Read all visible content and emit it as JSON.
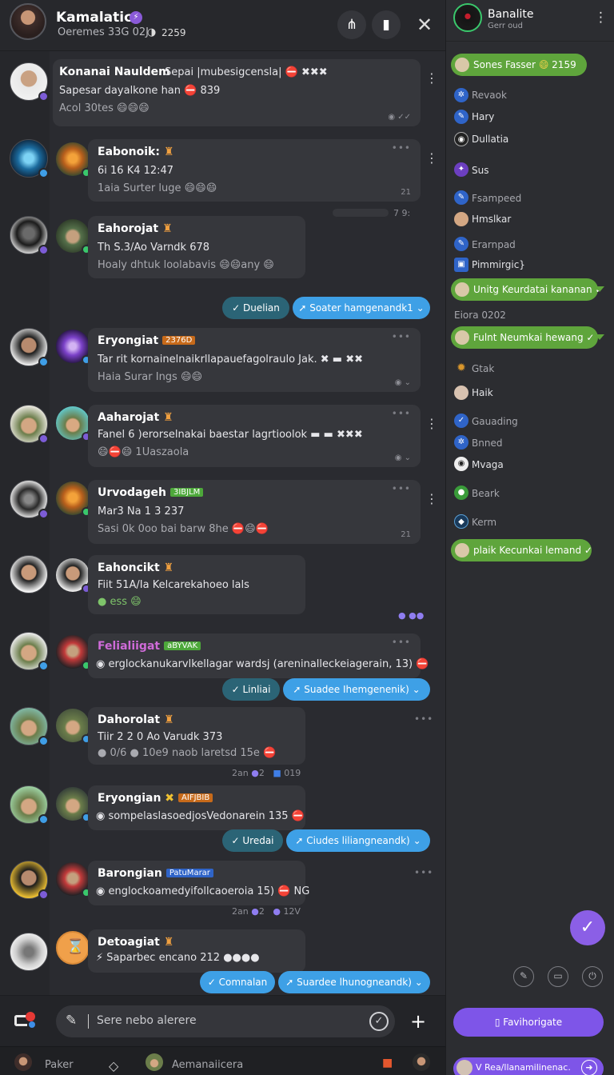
{
  "header": {
    "title": "Kamalatica",
    "subtitle": "Oeremes 33G 02J",
    "time": "2259",
    "badge": "⚡"
  },
  "messages": [
    {
      "name": "Konanai Nauldem",
      "tag": "",
      "lines": [
        "Sepai |mubesigcensla| ⛔ ✖✖✖",
        "Sapesar dayalkone han ⛔ 839",
        "Acol 30tes 😄😄😄"
      ],
      "time": ""
    },
    {
      "name": "Eabonoik:",
      "tag": "",
      "lines": [
        "6i 16 K4 12:47",
        "1aia Surter luge 😄😄😄"
      ],
      "time": "21"
    },
    {
      "name": "Eahorojat",
      "tag": "",
      "lines": [
        "Th S.3/Ao Varndk 678",
        "Hoaly dhtuk loolabavis 😄😄any 😄"
      ],
      "time": ""
    },
    {
      "name": "Eryongiat",
      "tag": "2376D",
      "lines": [
        "Tar rit kornainelnaikrllapauefagolraulo Jak. ✖ ▬ ✖✖",
        "Haia Surar Ings 😄😄"
      ],
      "time": ""
    },
    {
      "name": "Aaharojat",
      "tag": "",
      "lines": [
        "Fanel 6 )erorselnakai baestar lagrtioolok ▬ ▬ ✖✖✖",
        "😄⛔😄 1Uaszaola"
      ],
      "time": ""
    },
    {
      "name": "Urvodageh",
      "tag": "3IBJLM",
      "lines": [
        "Mar3 Na 1 3 237",
        "Sasi 0k 0oo bai barw 8he ⛔😄⛔"
      ],
      "time": "21"
    },
    {
      "name": "Eahoncikt",
      "tag": "",
      "lines": [
        "Fiit 51A/Ia Kelcarekahoeo lals",
        "● ess 😄"
      ],
      "time": ""
    },
    {
      "name": "Felialiigat",
      "tag": "aBYVAK",
      "lines": [
        "◉ erglockanukarvlkellagar wardsj (areninalleckeiagerain, 13) ⛔"
      ],
      "time": ""
    },
    {
      "name": "Dahorolat",
      "tag": "",
      "lines": [
        "Tiir 2 2 0 Ao Varudk 373",
        "● 0/6 ● 10e9 naob laretsd 15e ⛔"
      ],
      "time": ""
    },
    {
      "name": "Eryongian",
      "tag": "AIFJBIB",
      "lines": [
        "◉ sompelaslasoedjosVedonarein 135 ⛔"
      ],
      "time": ""
    },
    {
      "name": "Barongian",
      "tag": "PatuMarar",
      "lines": [
        "◉ englockoamedyifollcaoeroia 15) ⛔ NG"
      ],
      "time": ""
    },
    {
      "name": "Detoagiat",
      "tag": "",
      "lines": [
        "⚡ Saparbec encano 212 ●●●●"
      ],
      "time": ""
    }
  ],
  "actions": [
    {
      "left": "Duelian",
      "right": "Soater hamgenandk1"
    },
    {
      "left": "Linliai",
      "right": "Suadee Ihemgenenik)"
    },
    {
      "left": "Uredai",
      "right": "Ciudes liliangneandk)"
    },
    {
      "left": "Comnalan",
      "right": "Suardee lhunogneandk)"
    }
  ],
  "reactions": [
    {
      "a": "2an",
      "b": "2",
      "c": "019"
    },
    {
      "a": "2an",
      "b": "2",
      "c": "12V"
    }
  ],
  "composer": {
    "placeholder": "Sere nebo alerere"
  },
  "bottombar": {
    "left_label": "Paker",
    "center_label": "Aemanaiicera"
  },
  "sidebar": {
    "title": "Banalite",
    "subtitle": "Gerr oud",
    "groups": [
      {
        "pill": "Sones Fasser",
        "pill_time": "2159",
        "items": [
          "Revaok",
          "Hary",
          "Dullatia",
          "Sus"
        ]
      },
      {
        "pill": "",
        "pill_time": "",
        "items": [
          "Fsampeed",
          "Hmslkar",
          "Erarnpad",
          "Pimmirgic}"
        ]
      },
      {
        "pill": "Unitg Keurdatai kananan",
        "pill_time": "",
        "items": []
      },
      {
        "pill": "Fulnt Neumkai hewang",
        "pill_time": "",
        "items": [
          "Gtak",
          "Haik",
          "Gauading",
          "Bnned",
          "Mvaga",
          "Beark",
          "Kerm"
        ]
      },
      {
        "pill": "plaik Kecunkai lemand",
        "pill_time": "",
        "items": []
      }
    ],
    "divider_label": "Eiora 0202",
    "primary_button": "Favihorigate",
    "footer_label": "V Rea/llanamilinenac."
  },
  "colors": {
    "accent_green": "#5fa53c",
    "accent_blue": "#3ea0e6",
    "accent_purple": "#7e55e8"
  }
}
